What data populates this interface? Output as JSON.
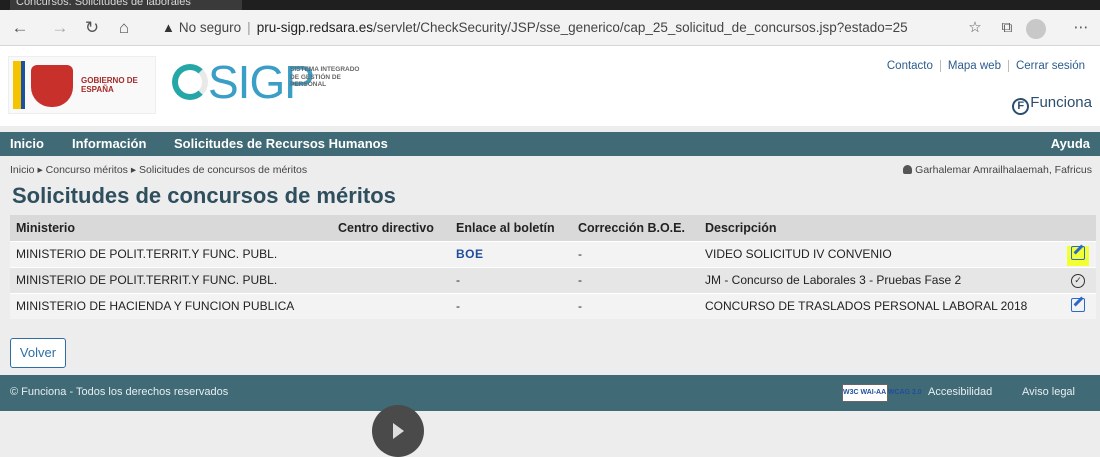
{
  "browser": {
    "tab_title": "Concursos. Solicitudes de laborales",
    "security_label": "No seguro",
    "url_host": "pru-sigp.redsara.es",
    "url_path": "/servlet/CheckSecurity/JSP/sse_generico/cap_25_solicitud_de_concursos.jsp?estado=25"
  },
  "header": {
    "gov_name": "GOBIERNO DE ESPAÑA",
    "sigp_word": "SIGP",
    "sigp_subtitle": "SISTEMA INTEGRADO DE GESTIÓN DE PERSONAL",
    "top_links": [
      "Contacto",
      "Mapa web",
      "Cerrar sesión"
    ],
    "funciona_label": "Funciona",
    "funciona_letter": "F"
  },
  "nav": {
    "items": [
      "Inicio",
      "Información",
      "Solicitudes de Recursos Humanos"
    ],
    "help": "Ayuda"
  },
  "breadcrumb": {
    "items": [
      "Inicio",
      "Concurso méritos",
      "Solicitudes de concursos de méritos"
    ],
    "separator": "▸",
    "user": "Garhalemar Amrailhalaemah, Fafricus"
  },
  "page_title": "Solicitudes de concursos de méritos",
  "table": {
    "columns": [
      "Ministerio",
      "Centro directivo",
      "Enlace al boletín",
      "Corrección B.O.E.",
      "Descripción",
      ""
    ],
    "rows": [
      {
        "ministerio": "MINISTERIO DE POLIT.TERRIT.Y FUNC. PUBL.",
        "centro": "",
        "enlace": "BOE",
        "correccion": "-",
        "descripcion": "VIDEO SOLICITUD IV CONVENIO",
        "action_icon": "edit-icon",
        "highlighted": true
      },
      {
        "ministerio": "MINISTERIO DE POLIT.TERRIT.Y FUNC. PUBL.",
        "centro": "",
        "enlace": "-",
        "correccion": "-",
        "descripcion": "JM - Concurso de Laborales 3 - Pruebas Fase 2",
        "action_icon": "check-circle-icon",
        "highlighted": false
      },
      {
        "ministerio": "MINISTERIO DE HACIENDA Y FUNCION PUBLICA",
        "centro": "",
        "enlace": "-",
        "correccion": "-",
        "descripcion": "CONCURSO DE TRASLADOS PERSONAL LABORAL 2018",
        "action_icon": "edit-icon",
        "highlighted": false
      }
    ]
  },
  "buttons": {
    "volver": "Volver"
  },
  "footer": {
    "copyright": "© Funciona - Todos los derechos reservados",
    "w3c_badge": "W3C WAI-AA WCAG 2.0",
    "accesibilidad": "Accesibilidad",
    "aviso_legal": "Aviso legal"
  },
  "colors": {
    "nav_bg": "#3f6a76",
    "title": "#2f4f5f",
    "link": "#2f6ea5",
    "highlight": "#f2ff35"
  }
}
